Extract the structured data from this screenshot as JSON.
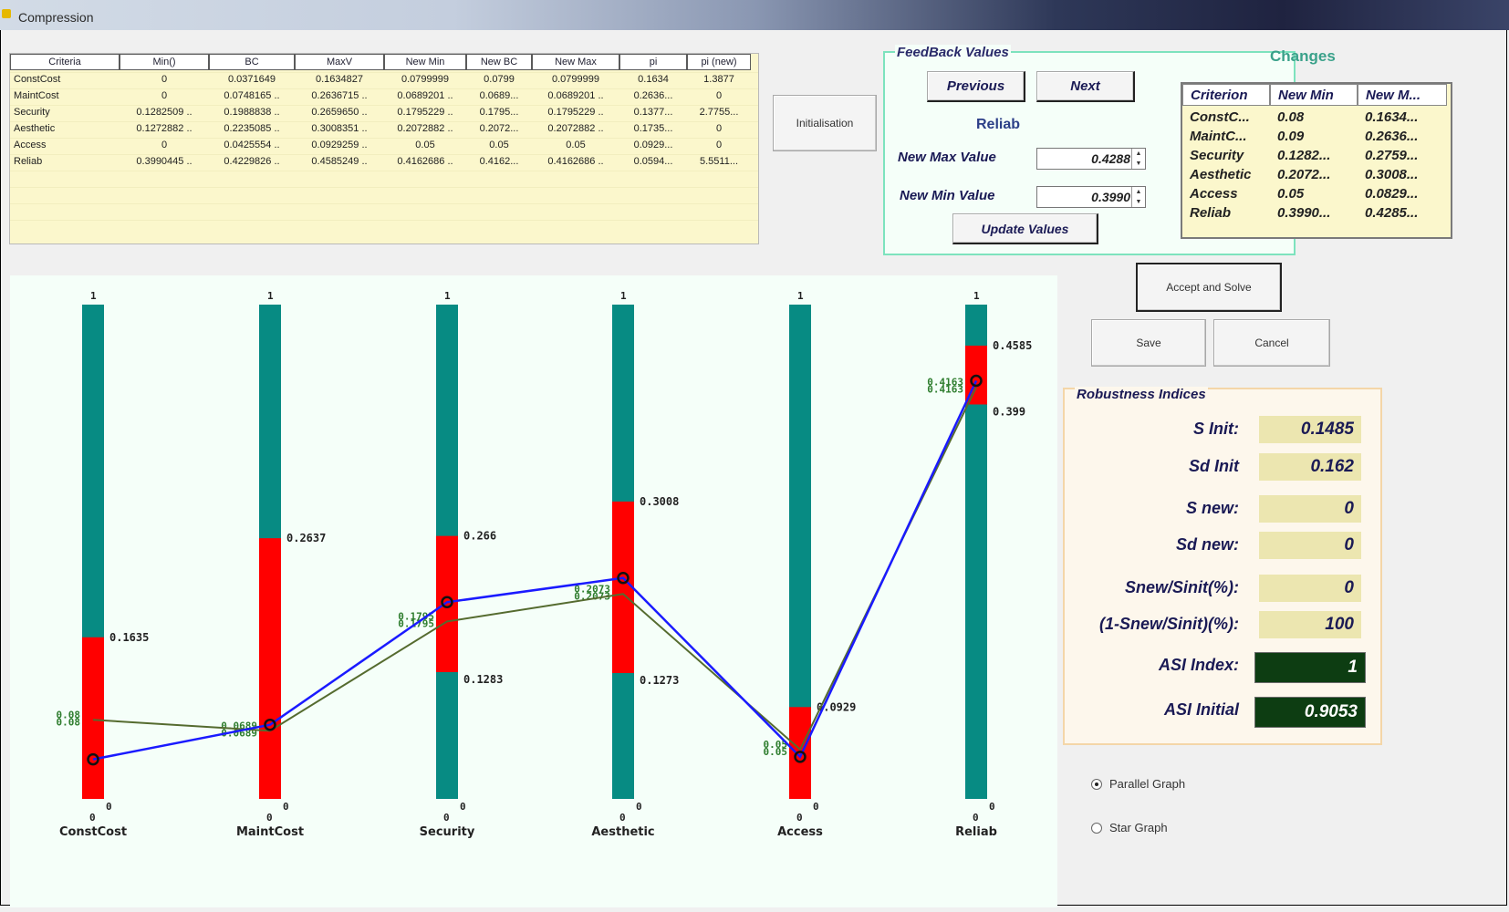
{
  "window": {
    "title": "Compression"
  },
  "grid": {
    "headers": [
      "Criteria",
      "Min()",
      "BC",
      "MaxV",
      "New Min",
      "New BC",
      "New Max",
      "pi",
      "pi (new)"
    ],
    "rows": [
      [
        "ConstCost",
        "0",
        "0.0371649",
        "0.1634827",
        "0.0799999",
        "0.0799",
        "0.0799999",
        "0.1634",
        "1.3877"
      ],
      [
        "MaintCost",
        "0",
        "0.0748165 ..",
        "0.2636715 ..",
        "0.0689201 ..",
        "0.0689...",
        "0.0689201 ..",
        "0.2636...",
        "0"
      ],
      [
        "Security",
        "0.1282509 ..",
        "0.1988838 ..",
        "0.2659650 ..",
        "0.1795229 ..",
        "0.1795...",
        "0.1795229 ..",
        "0.1377...",
        "2.7755..."
      ],
      [
        "Aesthetic",
        "0.1272882 ..",
        "0.2235085 ..",
        "0.3008351 ..",
        "0.2072882 ..",
        "0.2072...",
        "0.2072882 ..",
        "0.1735...",
        "0"
      ],
      [
        "Access",
        "0",
        "0.0425554 ..",
        "0.0929259 ..",
        "0.05",
        "0.05",
        "0.05",
        "0.0929...",
        "0"
      ],
      [
        "Reliab",
        "0.3990445 ..",
        "0.4229826 ..",
        "0.4585249 ..",
        "0.4162686 ..",
        "0.4162...",
        "0.4162686 ..",
        "0.0594...",
        "5.5511..."
      ]
    ]
  },
  "buttons": {
    "initialisation": "Initialisation",
    "previous": "Previous",
    "next": "Next",
    "update_values": "Update Values",
    "accept_and_solve": "Accept and Solve",
    "save": "Save",
    "cancel": "Cancel"
  },
  "feedback": {
    "legend": "FeedBack Values",
    "criterion": "Reliab",
    "new_max_label": "New Max Value",
    "new_max_value": "0.4288",
    "new_min_label": "New Min Value",
    "new_min_value": "0.3990"
  },
  "changes": {
    "title": "Changes",
    "headers": [
      "Criterion",
      "New Min",
      "New M..."
    ],
    "rows": [
      [
        "ConstC...",
        "0.08",
        "0.1634..."
      ],
      [
        "MaintC...",
        "0.09",
        "0.2636..."
      ],
      [
        "Security",
        "0.1282...",
        "0.2759..."
      ],
      [
        "Aesthetic",
        "0.2072...",
        "0.3008..."
      ],
      [
        "Access",
        "0.05",
        "0.0829..."
      ],
      [
        "Reliab",
        "0.3990...",
        "0.4285..."
      ]
    ]
  },
  "robustness": {
    "legend": "Robustness Indices",
    "items": [
      {
        "label": "S Init:",
        "value": "0.1485"
      },
      {
        "label": "Sd Init",
        "value": "0.162"
      },
      {
        "label": "S new:",
        "value": "0"
      },
      {
        "label": "Sd new:",
        "value": "0"
      },
      {
        "label": "Snew/Sinit(%):",
        "value": "0"
      },
      {
        "label": "(1-Snew/Sinit)(%):",
        "value": "100"
      },
      {
        "label": "ASI Index:",
        "value": "1"
      },
      {
        "label": "ASI Initial",
        "value": "0.9053"
      }
    ]
  },
  "graph_type": {
    "options": [
      "Parallel Graph",
      "Star Graph"
    ],
    "selected": "Parallel Graph"
  },
  "colors": {
    "axis_bar": "#078b83",
    "range_band": "#ff0000",
    "blue_line": "#1a1aff",
    "green_line": "#556b2f"
  },
  "chart_data": {
    "type": "line",
    "axis_min_label": "0",
    "axis_max_label": "1",
    "axes": [
      {
        "name": "ConstCost",
        "range_low": 0,
        "range_high": 0.1635,
        "high_label": "0.1635",
        "low_label": "",
        "blue": 0.04,
        "green": 0.08,
        "left_labels": [
          "0.08",
          "0.08"
        ]
      },
      {
        "name": "MaintCost",
        "range_low": 0,
        "range_high": 0.2637,
        "high_label": "0.2637",
        "low_label": "",
        "blue": 0.075,
        "green": 0.0689,
        "left_labels": [
          "0.0689",
          "0.0689"
        ]
      },
      {
        "name": "Security",
        "range_low": 0.1283,
        "range_high": 0.266,
        "high_label": "0.266",
        "low_label": "0.1283",
        "blue": 0.199,
        "green": 0.1795,
        "left_labels": [
          "0.1795",
          "0.1795"
        ]
      },
      {
        "name": "Aesthetic",
        "range_low": 0.1273,
        "range_high": 0.3008,
        "high_label": "0.3008",
        "low_label": "0.1273",
        "blue": 0.2235,
        "green": 0.2073,
        "left_labels": [
          "0.2073",
          "0.2073"
        ]
      },
      {
        "name": "Access",
        "range_low": 0,
        "range_high": 0.0929,
        "high_label": "0.0929",
        "low_label": "",
        "blue": 0.0426,
        "green": 0.05,
        "left_labels": [
          "0.05",
          "0.05"
        ]
      },
      {
        "name": "Reliab",
        "range_low": 0.399,
        "range_high": 0.4585,
        "high_label": "0.4585",
        "low_label": "0.399",
        "blue": 0.423,
        "green": 0.4163,
        "left_labels": [
          "0.4163",
          "0.4163"
        ]
      }
    ]
  }
}
